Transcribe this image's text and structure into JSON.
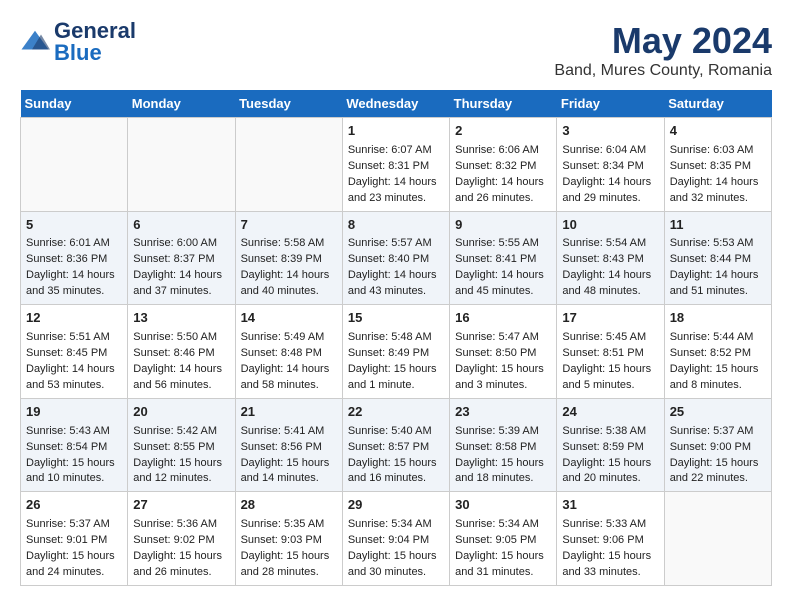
{
  "header": {
    "logo_text_general": "General",
    "logo_text_blue": "Blue",
    "title": "May 2024",
    "subtitle": "Band, Mures County, Romania"
  },
  "days_of_week": [
    "Sunday",
    "Monday",
    "Tuesday",
    "Wednesday",
    "Thursday",
    "Friday",
    "Saturday"
  ],
  "weeks": [
    [
      {
        "day": "",
        "info": ""
      },
      {
        "day": "",
        "info": ""
      },
      {
        "day": "",
        "info": ""
      },
      {
        "day": "1",
        "info": "Sunrise: 6:07 AM\nSunset: 8:31 PM\nDaylight: 14 hours\nand 23 minutes."
      },
      {
        "day": "2",
        "info": "Sunrise: 6:06 AM\nSunset: 8:32 PM\nDaylight: 14 hours\nand 26 minutes."
      },
      {
        "day": "3",
        "info": "Sunrise: 6:04 AM\nSunset: 8:34 PM\nDaylight: 14 hours\nand 29 minutes."
      },
      {
        "day": "4",
        "info": "Sunrise: 6:03 AM\nSunset: 8:35 PM\nDaylight: 14 hours\nand 32 minutes."
      }
    ],
    [
      {
        "day": "5",
        "info": "Sunrise: 6:01 AM\nSunset: 8:36 PM\nDaylight: 14 hours\nand 35 minutes."
      },
      {
        "day": "6",
        "info": "Sunrise: 6:00 AM\nSunset: 8:37 PM\nDaylight: 14 hours\nand 37 minutes."
      },
      {
        "day": "7",
        "info": "Sunrise: 5:58 AM\nSunset: 8:39 PM\nDaylight: 14 hours\nand 40 minutes."
      },
      {
        "day": "8",
        "info": "Sunrise: 5:57 AM\nSunset: 8:40 PM\nDaylight: 14 hours\nand 43 minutes."
      },
      {
        "day": "9",
        "info": "Sunrise: 5:55 AM\nSunset: 8:41 PM\nDaylight: 14 hours\nand 45 minutes."
      },
      {
        "day": "10",
        "info": "Sunrise: 5:54 AM\nSunset: 8:43 PM\nDaylight: 14 hours\nand 48 minutes."
      },
      {
        "day": "11",
        "info": "Sunrise: 5:53 AM\nSunset: 8:44 PM\nDaylight: 14 hours\nand 51 minutes."
      }
    ],
    [
      {
        "day": "12",
        "info": "Sunrise: 5:51 AM\nSunset: 8:45 PM\nDaylight: 14 hours\nand 53 minutes."
      },
      {
        "day": "13",
        "info": "Sunrise: 5:50 AM\nSunset: 8:46 PM\nDaylight: 14 hours\nand 56 minutes."
      },
      {
        "day": "14",
        "info": "Sunrise: 5:49 AM\nSunset: 8:48 PM\nDaylight: 14 hours\nand 58 minutes."
      },
      {
        "day": "15",
        "info": "Sunrise: 5:48 AM\nSunset: 8:49 PM\nDaylight: 15 hours\nand 1 minute."
      },
      {
        "day": "16",
        "info": "Sunrise: 5:47 AM\nSunset: 8:50 PM\nDaylight: 15 hours\nand 3 minutes."
      },
      {
        "day": "17",
        "info": "Sunrise: 5:45 AM\nSunset: 8:51 PM\nDaylight: 15 hours\nand 5 minutes."
      },
      {
        "day": "18",
        "info": "Sunrise: 5:44 AM\nSunset: 8:52 PM\nDaylight: 15 hours\nand 8 minutes."
      }
    ],
    [
      {
        "day": "19",
        "info": "Sunrise: 5:43 AM\nSunset: 8:54 PM\nDaylight: 15 hours\nand 10 minutes."
      },
      {
        "day": "20",
        "info": "Sunrise: 5:42 AM\nSunset: 8:55 PM\nDaylight: 15 hours\nand 12 minutes."
      },
      {
        "day": "21",
        "info": "Sunrise: 5:41 AM\nSunset: 8:56 PM\nDaylight: 15 hours\nand 14 minutes."
      },
      {
        "day": "22",
        "info": "Sunrise: 5:40 AM\nSunset: 8:57 PM\nDaylight: 15 hours\nand 16 minutes."
      },
      {
        "day": "23",
        "info": "Sunrise: 5:39 AM\nSunset: 8:58 PM\nDaylight: 15 hours\nand 18 minutes."
      },
      {
        "day": "24",
        "info": "Sunrise: 5:38 AM\nSunset: 8:59 PM\nDaylight: 15 hours\nand 20 minutes."
      },
      {
        "day": "25",
        "info": "Sunrise: 5:37 AM\nSunset: 9:00 PM\nDaylight: 15 hours\nand 22 minutes."
      }
    ],
    [
      {
        "day": "26",
        "info": "Sunrise: 5:37 AM\nSunset: 9:01 PM\nDaylight: 15 hours\nand 24 minutes."
      },
      {
        "day": "27",
        "info": "Sunrise: 5:36 AM\nSunset: 9:02 PM\nDaylight: 15 hours\nand 26 minutes."
      },
      {
        "day": "28",
        "info": "Sunrise: 5:35 AM\nSunset: 9:03 PM\nDaylight: 15 hours\nand 28 minutes."
      },
      {
        "day": "29",
        "info": "Sunrise: 5:34 AM\nSunset: 9:04 PM\nDaylight: 15 hours\nand 30 minutes."
      },
      {
        "day": "30",
        "info": "Sunrise: 5:34 AM\nSunset: 9:05 PM\nDaylight: 15 hours\nand 31 minutes."
      },
      {
        "day": "31",
        "info": "Sunrise: 5:33 AM\nSunset: 9:06 PM\nDaylight: 15 hours\nand 33 minutes."
      },
      {
        "day": "",
        "info": ""
      }
    ]
  ]
}
